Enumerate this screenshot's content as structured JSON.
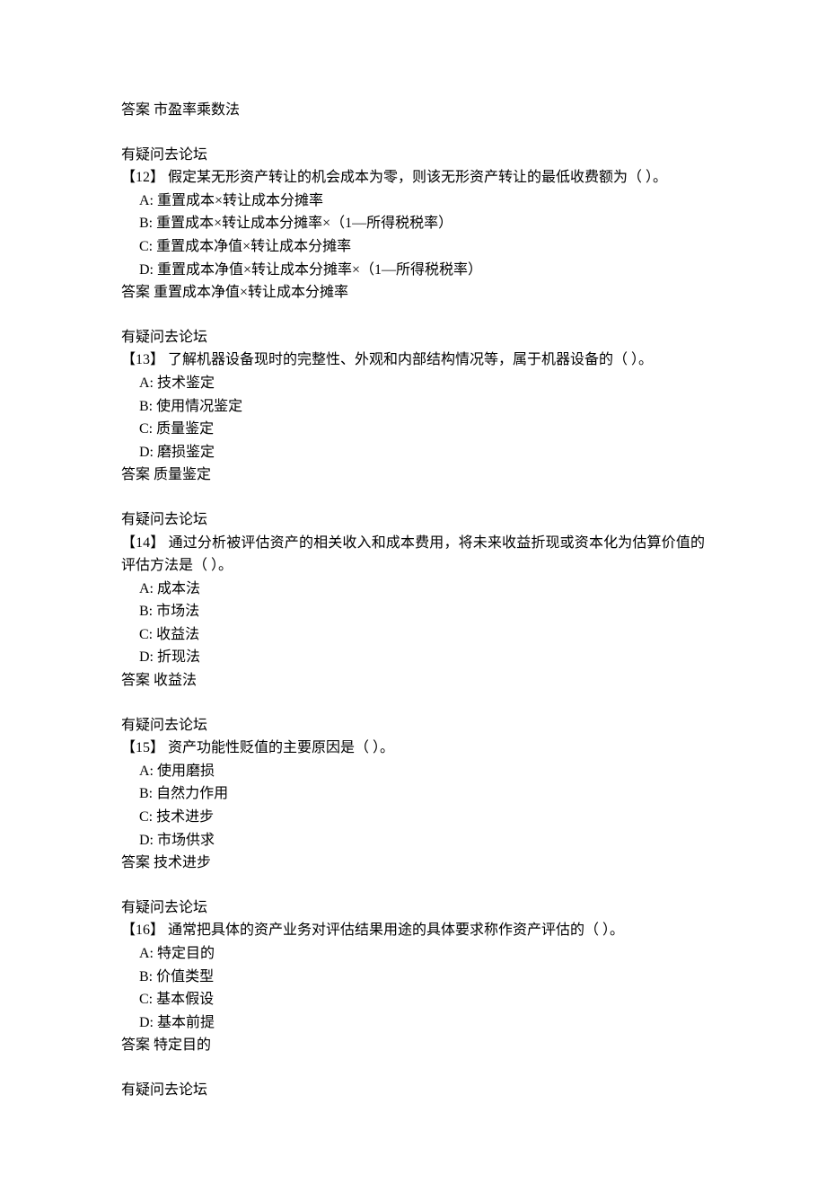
{
  "intro_answer": {
    "label": "答案",
    "value": "市盈率乘数法"
  },
  "forum_text": "有疑问去论坛",
  "answer_label": "答案",
  "questions": [
    {
      "number": "【12】",
      "text": "假定某无形资产转让的机会成本为零，则该无形资产转让的最低收费额为（ ）。",
      "options": [
        {
          "letter": "A:",
          "text": "重置成本×转让成本分摊率"
        },
        {
          "letter": "B:",
          "text": "重置成本×转让成本分摊率×（1—所得税税率）"
        },
        {
          "letter": "C:",
          "text": "重置成本净值×转让成本分摊率"
        },
        {
          "letter": "D:",
          "text": "重置成本净值×转让成本分摊率×（1—所得税税率）"
        }
      ],
      "answer": "重置成本净值×转让成本分摊率"
    },
    {
      "number": "【13】",
      "text": "了解机器设备现时的完整性、外观和内部结构情况等，属于机器设备的（ ）。",
      "options": [
        {
          "letter": "A:",
          "text": "技术鉴定"
        },
        {
          "letter": "B:",
          "text": "使用情况鉴定"
        },
        {
          "letter": "C:",
          "text": "质量鉴定"
        },
        {
          "letter": "D:",
          "text": "磨损鉴定"
        }
      ],
      "answer": "质量鉴定"
    },
    {
      "number": "【14】",
      "text": "通过分析被评估资产的相关收入和成本费用，将未来收益折现或资本化为估算价值的评估方法是（ ）。",
      "options": [
        {
          "letter": "A:",
          "text": "成本法"
        },
        {
          "letter": "B:",
          "text": "市场法"
        },
        {
          "letter": "C:",
          "text": "收益法"
        },
        {
          "letter": "D:",
          "text": "折现法"
        }
      ],
      "answer": "收益法"
    },
    {
      "number": "【15】",
      "text": "资产功能性贬值的主要原因是（ ）。",
      "options": [
        {
          "letter": "A:",
          "text": "使用磨损"
        },
        {
          "letter": "B:",
          "text": "自然力作用"
        },
        {
          "letter": "C:",
          "text": "技术进步"
        },
        {
          "letter": "D:",
          "text": "市场供求"
        }
      ],
      "answer": "技术进步"
    },
    {
      "number": "【16】",
      "text": "通常把具体的资产业务对评估结果用途的具体要求称作资产评估的（ ）。",
      "options": [
        {
          "letter": "A:",
          "text": "特定目的"
        },
        {
          "letter": "B:",
          "text": "价值类型"
        },
        {
          "letter": "C:",
          "text": "基本假设"
        },
        {
          "letter": "D:",
          "text": "基本前提"
        }
      ],
      "answer": "特定目的"
    }
  ]
}
